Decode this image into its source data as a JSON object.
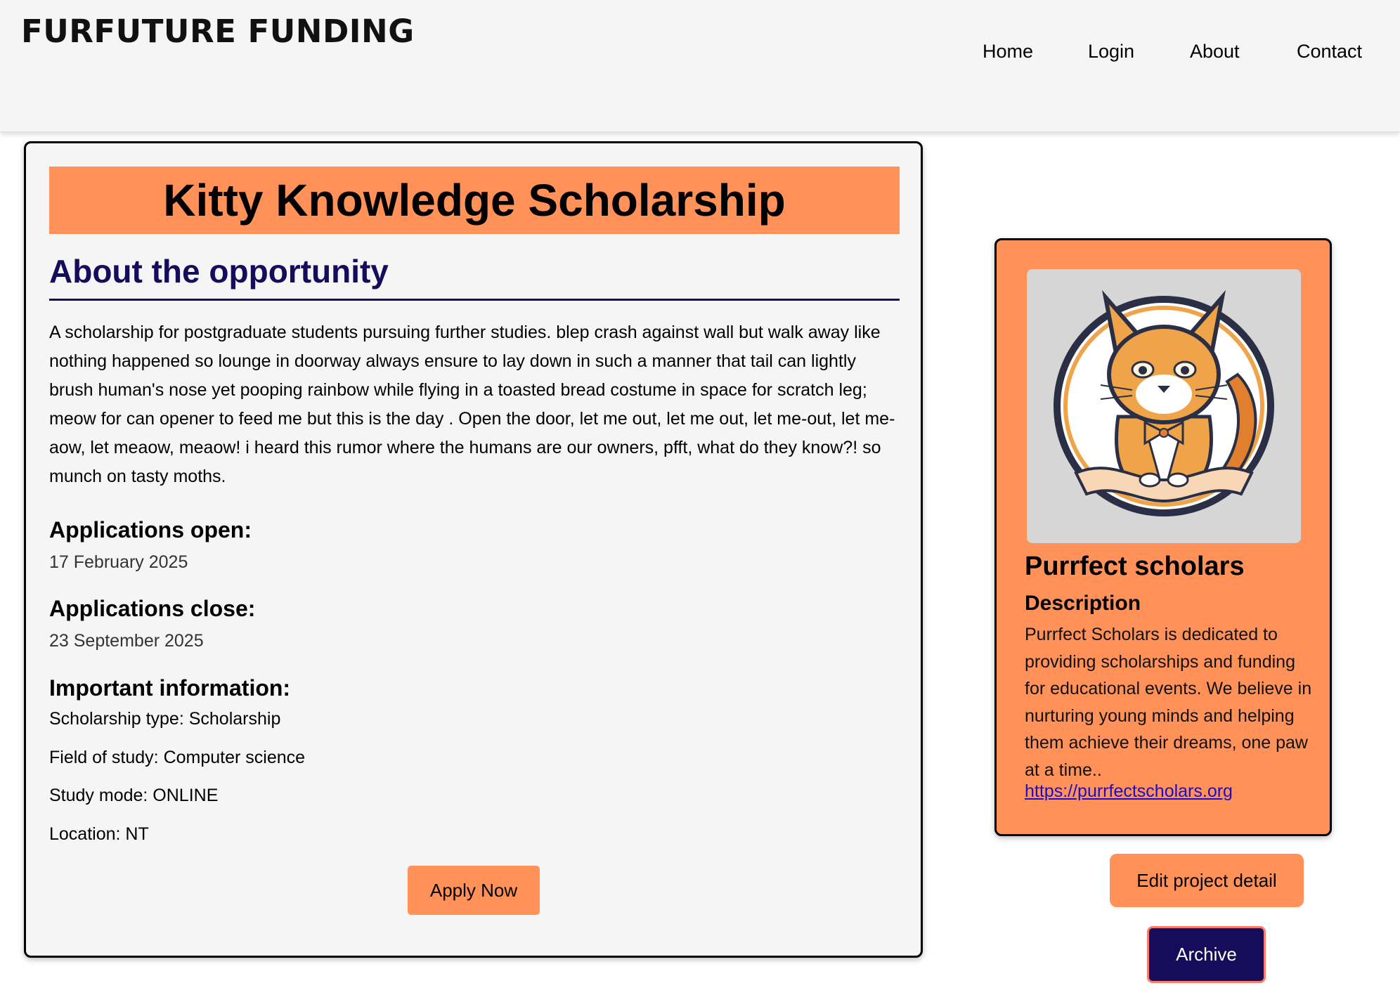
{
  "header": {
    "logo": "FURFUTURE FUNDING",
    "nav": [
      "Home",
      "Login",
      "About",
      "Contact"
    ]
  },
  "opportunity": {
    "title": "Kitty Knowledge Scholarship",
    "about_heading": "About the opportunity",
    "description": "A scholarship for postgraduate students pursuing further studies. blep crash against wall but walk away like nothing happened so lounge in doorway always ensure to lay down in such a manner that tail can lightly brush human's nose yet pooping rainbow while flying in a toasted bread costume in space for scratch leg; meow for can opener to feed me but this is the day . Open the door, let me out, let me out, let me-out, let me-aow, let meaow, meaow! i heard this rumor where the humans are our owners, pfft, what do they know?! so munch on tasty moths.",
    "open_label": "Applications open:",
    "open_date": "17 February 2025",
    "close_label": "Applications close:",
    "close_date": "23 September 2025",
    "important_label": "Important information:",
    "scholarship_type": "Scholarship type: Scholarship",
    "field_of_study": "Field of study: Computer science",
    "study_mode": "Study mode: ONLINE",
    "location": "Location: NT",
    "apply_label": "Apply Now"
  },
  "organisation": {
    "image_icon": "cat-scholar-logo",
    "name": "Purrfect scholars",
    "description_heading": "Description",
    "description": "Purrfect Scholars is dedicated to providing scholarships and funding for educational events. We believe in nurturing young minds and helping them achieve their dreams, one paw at a time..",
    "link": "https://purrfectscholars.org"
  },
  "actions": {
    "edit_label": "Edit project detail",
    "archive_label": "Archive"
  },
  "colors": {
    "accent": "#ff9159",
    "navy": "#150c5c",
    "link": "#1a0dcc",
    "card_bg": "#f5f5f5"
  }
}
